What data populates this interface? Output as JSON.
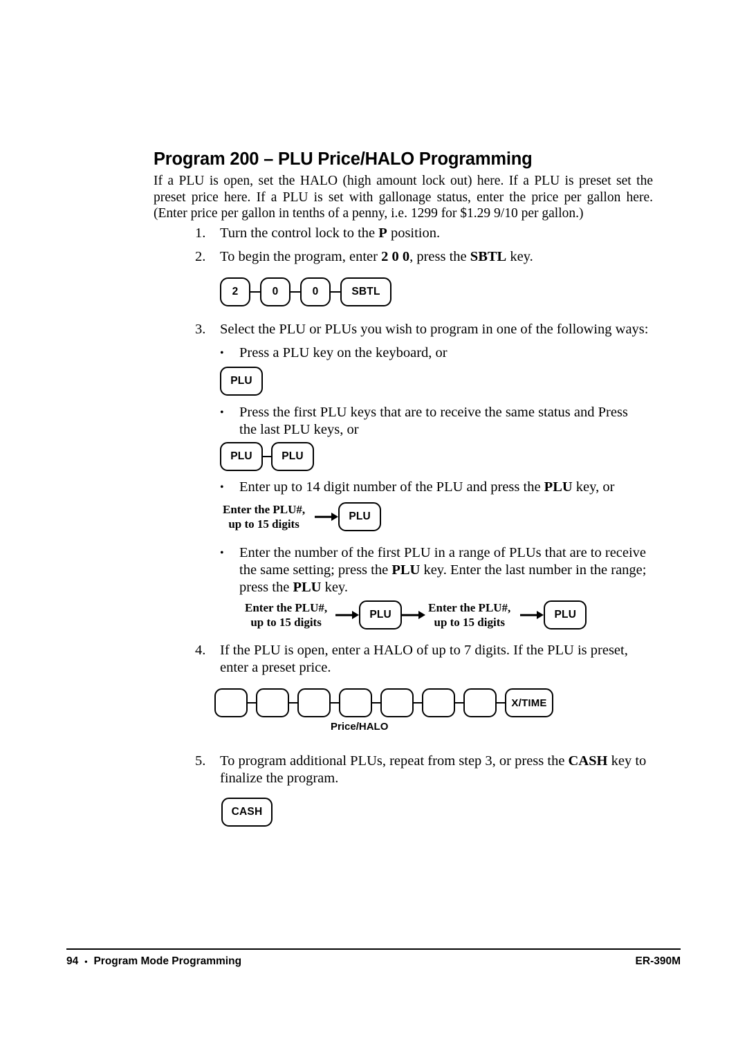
{
  "document": {
    "title": "Program 200 – PLU Price/HALO Programming",
    "intro": "If a PLU is open, set the HALO (high amount lock out) here.    If a PLU is preset set the preset price here.    If a PLU is set with gallonage status, enter the price per gallon here.    (Enter price per gallon in tenths of a penny, i.e. 1299 for $1.29 9/10 per gallon.)"
  },
  "steps": {
    "one": {
      "number": "1.",
      "pre": "Turn the control lock to the ",
      "bold": "P",
      "post": " position."
    },
    "two": {
      "number": "2.",
      "pre": "To begin the program, enter ",
      "bold1": "2 0 0",
      "mid": ", press the ",
      "bold2": "SBTL",
      "post": " key."
    },
    "three": {
      "number": "3.",
      "text": "Select the PLU or PLUs you wish to program in one of the following ways:"
    },
    "four": {
      "number": "4.",
      "text": "If the PLU is open, enter a HALO of up to 7 digits.    If the PLU is preset, enter a preset price."
    },
    "five": {
      "number": "5.",
      "pre": "To program additional PLUs, repeat from step 3, or press the ",
      "bold": "CASH",
      "post": " key to finalize the program."
    }
  },
  "bullets": {
    "b1": {
      "marker": "•",
      "text": "Press a PLU key on the keyboard, or"
    },
    "b2": {
      "marker": "•",
      "text": "Press the first PLU keys that are to receive the same status and Press the last PLU keys, or"
    },
    "b3": {
      "marker": "•",
      "pre": "Enter up to 14 digit number of the PLU and press the ",
      "bold": "PLU",
      "post": " key, or"
    },
    "b4": {
      "marker": "•",
      "pre": "Enter the number of the first PLU in a range of PLUs that are to receive the same setting; press the ",
      "bold1": "PLU",
      "mid": " key.    Enter the last number in the range; press the ",
      "bold2": "PLU",
      "post": " key."
    }
  },
  "diagrams": {
    "sbtl_sequence": {
      "keys": [
        "2",
        "0",
        "0",
        "SBTL"
      ]
    },
    "single_plu": {
      "keys": [
        "PLU"
      ]
    },
    "double_plu": {
      "keys": [
        "PLU",
        "PLU"
      ]
    },
    "plu_number_entry": {
      "label_line1": "Enter the PLU#,",
      "label_line2": "up to 15 digits",
      "key": "PLU"
    },
    "plu_range_entry": {
      "label1_line1": "Enter the PLU#,",
      "label1_line2": "up to 15 digits",
      "key1": "PLU",
      "label2_line1": "Enter the PLU#,",
      "label2_line2": "up to 15 digits",
      "key2": "PLU"
    },
    "price_halo": {
      "blank_key_count": 7,
      "blank_keys": [
        "",
        "",
        "",
        "",
        "",
        "",
        ""
      ],
      "final_key": "X/TIME",
      "caption": "Price/HALO"
    },
    "cash_key": {
      "keys": [
        "CASH"
      ]
    }
  },
  "footer": {
    "page_number": "94",
    "separator": "•",
    "section": "Program Mode Programming",
    "model": "ER-390M"
  }
}
